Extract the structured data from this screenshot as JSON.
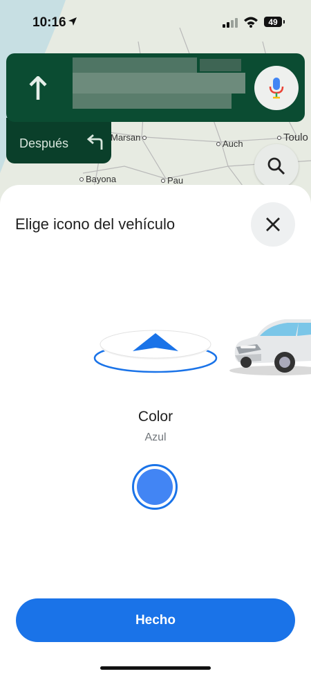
{
  "status_bar": {
    "time": "10:16",
    "battery": "49"
  },
  "map": {
    "cities": [
      {
        "name": "Marsan"
      },
      {
        "name": "Auch"
      },
      {
        "name": "Toulo"
      },
      {
        "name": "Bayona"
      },
      {
        "name": "Pau"
      }
    ]
  },
  "navigation": {
    "next_label": "Después",
    "direction_icon": "arrow-up-icon",
    "next_turn_icon": "turn-left-icon",
    "colors": {
      "card": "#0b4c32"
    }
  },
  "sheet": {
    "title": "Elige icono del vehículo",
    "icons": [
      "navigation-arrow-icon",
      "car-icon"
    ],
    "color_label": "Color",
    "color_value": "Azul",
    "selected_color": "#4285f4",
    "done_label": "Hecho",
    "accent": "#1a73e8"
  }
}
